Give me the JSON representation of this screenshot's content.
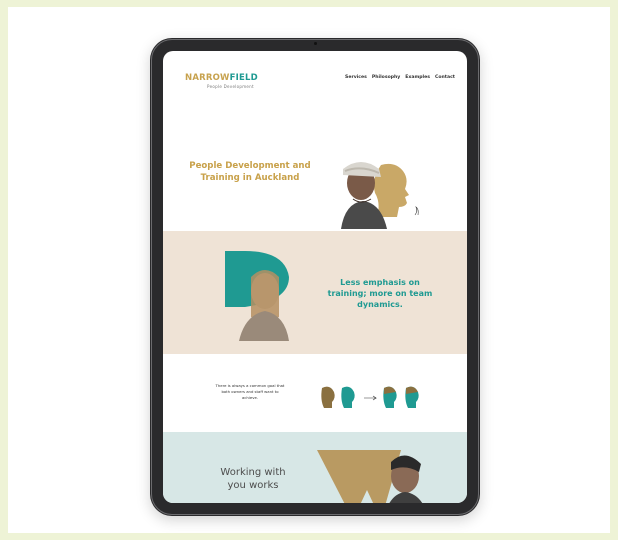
{
  "brand": {
    "logo_part1": "NARROW",
    "logo_part2": "FIELD",
    "tagline": "People Development"
  },
  "nav": {
    "items": [
      "Services",
      "Philosophy",
      "Examples",
      "Contact"
    ]
  },
  "hero": {
    "title": "People Development and Training in Auckland"
  },
  "section2": {
    "headline": "Less emphasis on training; more on team dynamics."
  },
  "section3": {
    "text": "There is always a common goal that both owners and staff want to achieve."
  },
  "section4": {
    "headline": "Working with you works"
  },
  "colors": {
    "background": "#eef3d6",
    "gold": "#c8a14a",
    "teal": "#1f9a92",
    "beige": "#efe3d6",
    "mint": "#d7e7e6",
    "device": "#2a2a2c"
  }
}
